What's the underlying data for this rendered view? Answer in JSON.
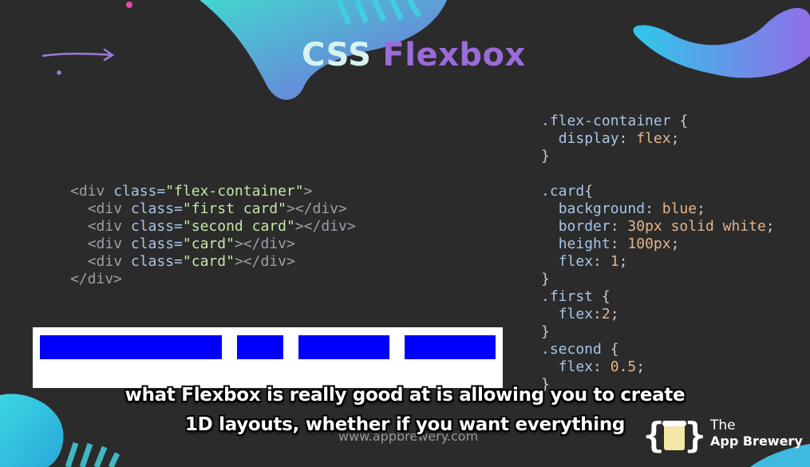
{
  "title": {
    "word1": "CSS",
    "word2": "Flexbox"
  },
  "html_code": [
    {
      "indent": "",
      "open": "<div ",
      "attr": "class=",
      "value": "\"flex-container\"",
      "close": ">",
      "end": ""
    },
    {
      "indent": "  ",
      "open": "<div ",
      "attr": "class=",
      "value": "\"first card\"",
      "close": "></",
      "end": "div>"
    },
    {
      "indent": "  ",
      "open": "<div ",
      "attr": "class=",
      "value": "\"second card\"",
      "close": "></",
      "end": "div>"
    },
    {
      "indent": "  ",
      "open": "<div ",
      "attr": "class=",
      "value": "\"card\"",
      "close": "></",
      "end": "div>"
    },
    {
      "indent": "  ",
      "open": "<div ",
      "attr": "class=",
      "value": "\"card\"",
      "close": "></",
      "end": "div>"
    },
    {
      "indent": "",
      "open": "</div>",
      "attr": "",
      "value": "",
      "close": "",
      "end": ""
    }
  ],
  "css_code": [
    {
      "kind": "sel",
      "text": ".flex-container",
      "tail": " {"
    },
    {
      "kind": "decl",
      "prop": "display",
      "value": "flex"
    },
    {
      "kind": "close",
      "text": "}"
    },
    {
      "kind": "blank"
    },
    {
      "kind": "sel",
      "text": ".card",
      "tail": "{"
    },
    {
      "kind": "decl",
      "prop": "background",
      "value": "blue"
    },
    {
      "kind": "decl",
      "prop": "border",
      "value": "30px solid white"
    },
    {
      "kind": "decl",
      "prop": "height",
      "value": "100px"
    },
    {
      "kind": "decl",
      "prop": "flex",
      "value": "1"
    },
    {
      "kind": "close",
      "text": "}"
    },
    {
      "kind": "sel",
      "text": ".first",
      "tail": " {"
    },
    {
      "kind": "decl-tight",
      "prop": "flex",
      "value": "2"
    },
    {
      "kind": "close",
      "text": "}"
    },
    {
      "kind": "sel",
      "text": ".second",
      "tail": " {"
    },
    {
      "kind": "decl",
      "prop": "flex",
      "value": "0.5"
    },
    {
      "kind": "close",
      "text": "}"
    }
  ],
  "demo": {
    "cards": [
      {
        "name": "first",
        "flex": 2
      },
      {
        "name": "second",
        "flex": 0.5
      },
      {
        "name": "card",
        "flex": 1
      },
      {
        "name": "card",
        "flex": 1
      }
    ]
  },
  "subtitle": {
    "line1": "what Flexbox is really good at is allowing you to create",
    "line2": "1D layouts, whether if you want everything"
  },
  "watermark": "www.appbrewery.com",
  "brand": {
    "line1": "The",
    "line2": "App Brewery"
  },
  "colors": {
    "card": "#0000ff",
    "accent_purple": "#9b6bd9",
    "accent_cyan": "#3fd2e0"
  }
}
